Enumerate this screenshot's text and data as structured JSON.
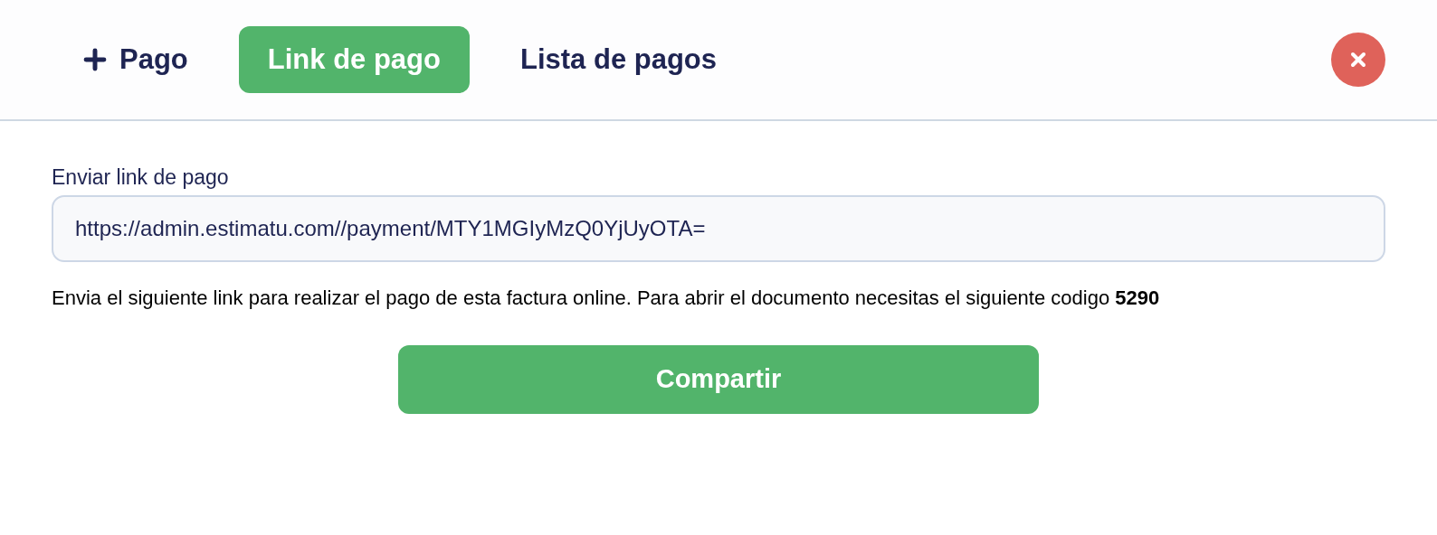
{
  "tabs": [
    {
      "label": "Pago",
      "selected": false,
      "kind": "add"
    },
    {
      "label": "Link de pago",
      "selected": true,
      "kind": "plain"
    },
    {
      "label": "Lista de pagos",
      "selected": false,
      "kind": "plain"
    }
  ],
  "link_field": {
    "label": "Enviar link de pago",
    "value": "https://admin.estimatu.com//payment/MTY1MGIyMzQ0YjUyOTA="
  },
  "message": "Envia el siguiente link para realizar el pago de esta factura online. Para abrir el documento necesitas el siguiente codigo **5290**",
  "share_button": "Compartir"
}
